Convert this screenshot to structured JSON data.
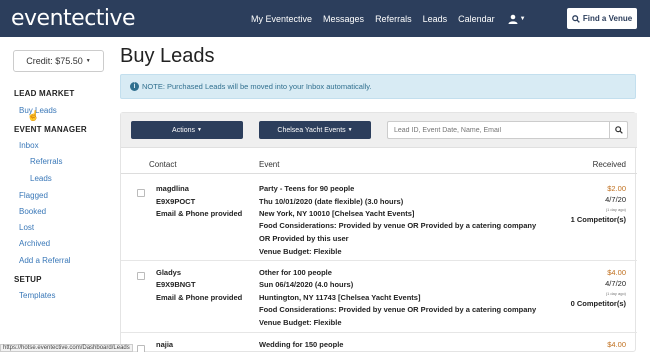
{
  "header": {
    "logo": "eventective",
    "nav": [
      "My Eventective",
      "Messages",
      "Referrals",
      "Leads",
      "Calendar"
    ],
    "find_venue": "Find a Venue"
  },
  "sidebar": {
    "credit": "Credit: $75.50",
    "lead_market_heading": "LEAD MARKET",
    "buy_leads": "Buy Leads",
    "event_manager_heading": "EVENT MANAGER",
    "inbox": "Inbox",
    "referrals": "Referrals",
    "leads": "Leads",
    "flagged": "Flagged",
    "booked": "Booked",
    "lost": "Lost",
    "archived": "Archived",
    "add_referral": "Add a Referral",
    "setup_heading": "SETUP",
    "templates": "Templates"
  },
  "main": {
    "title": "Buy Leads",
    "notice": "NOTE: Purchased Leads will be moved into your Inbox automatically.",
    "actions_label": "Actions",
    "venue_filter": "Chelsea Yacht Events",
    "search_placeholder": "Lead ID, Event Date, Name, Email",
    "columns": {
      "contact": "Contact",
      "event": "Event",
      "received": "Received"
    },
    "leads": [
      {
        "name": "magdlina",
        "lead_id": "E9X9POCT",
        "contact_info": "Email & Phone provided",
        "event_title": "Party - Teens for 90 people",
        "event_date": "Thu 10/01/2020 (date flexible) (3.0 hours)",
        "location": "New York, NY 10010 [Chelsea Yacht Events]",
        "food": "Food Considerations: Provided by venue OR Provided by a catering company",
        "food_extra": "OR Provided by this user",
        "budget": "Venue Budget: Flexible",
        "price": "$2.00",
        "received_date": "4/7/20",
        "ago": "(1 day ago)",
        "competitors": "1 Competitor(s)"
      },
      {
        "name": "Gladys",
        "lead_id": "E9X9BNGT",
        "contact_info": "Email & Phone provided",
        "event_title": "Other for 100 people",
        "event_date": "Sun 06/14/2020 (4.0 hours)",
        "location": "Huntington, NY 11743 [Chelsea Yacht Events]",
        "food": "Food Considerations: Provided by venue OR Provided by a catering company",
        "budget": "Venue Budget: Flexible",
        "price": "$4.00",
        "received_date": "4/7/20",
        "ago": "(1 day ago)",
        "competitors": "0 Competitor(s)"
      },
      {
        "name": "najia",
        "event_title": "Wedding for 150 people",
        "price": "$4.00"
      }
    ]
  },
  "status_url": "https://hotse.eventective.com/Dashboard/Leads"
}
